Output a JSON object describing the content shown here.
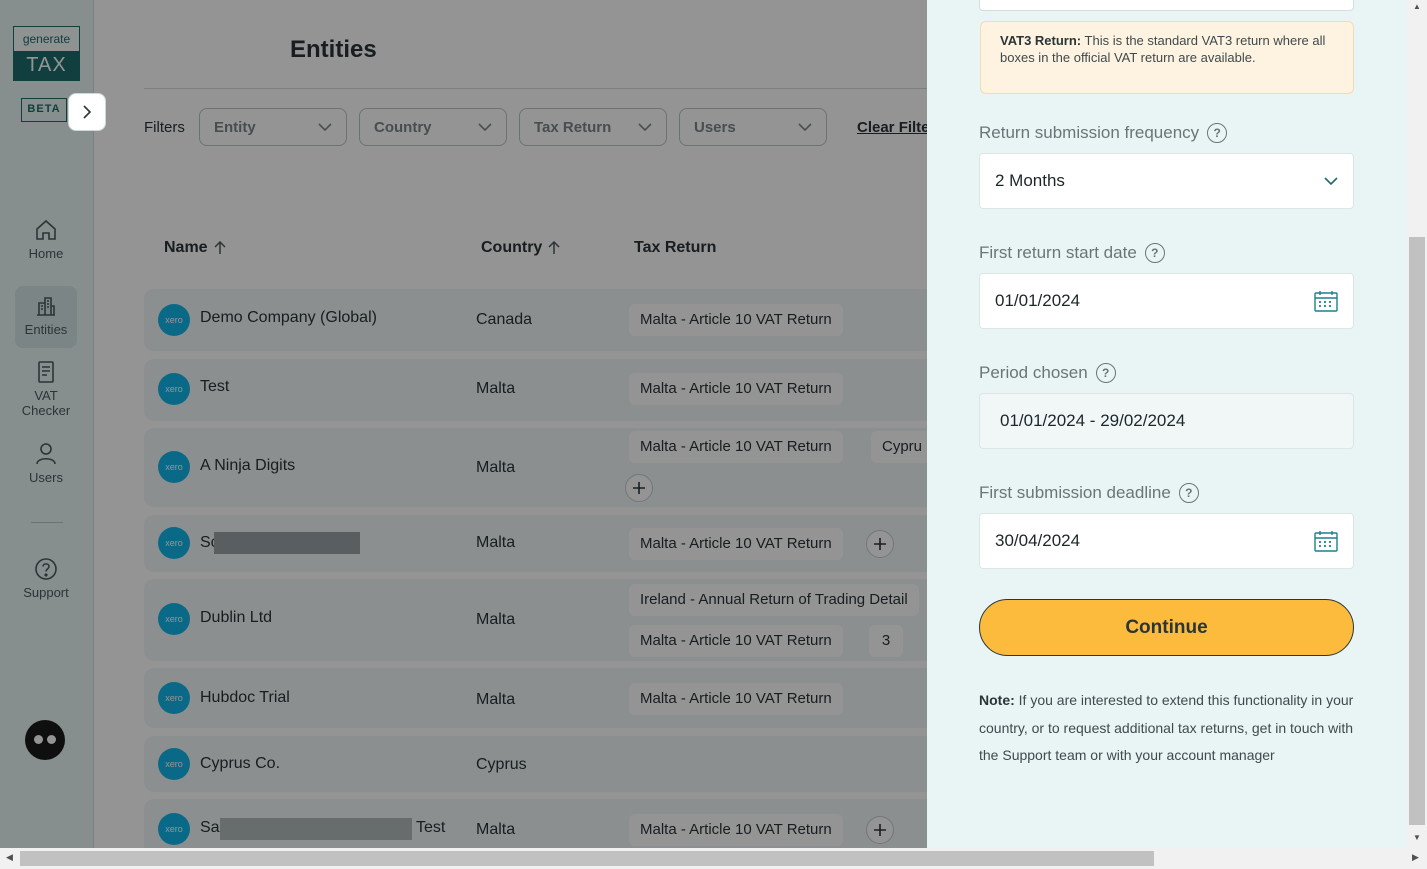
{
  "sidebar": {
    "logo_top": "generate",
    "logo_bottom": "TAX",
    "beta": "BETA",
    "nav": [
      {
        "label": "Home",
        "icon": "home-icon"
      },
      {
        "label": "Entities",
        "icon": "buildings-icon"
      },
      {
        "label": "VAT Checker",
        "icon": "document-icon"
      },
      {
        "label": "Users",
        "icon": "user-icon"
      },
      {
        "label": "Support",
        "icon": "help-circle-icon"
      }
    ]
  },
  "main": {
    "title": "Entities",
    "filters_label": "Filters",
    "filters": [
      "Entity",
      "Country",
      "Tax Return",
      "Users"
    ],
    "clear_filters": "Clear Filte",
    "columns": [
      "Name",
      "Country",
      "Tax Return"
    ],
    "rows": [
      {
        "name": "Demo Company (Global)",
        "country": "Canada",
        "tags": [
          "Malta - Article 10 VAT Return"
        ]
      },
      {
        "name": "Test",
        "country": "Malta",
        "tags": [
          "Malta - Article 10 VAT Return"
        ]
      },
      {
        "name": "A Ninja Digits",
        "country": "Malta",
        "tags": [
          "Malta - Article 10 VAT Return",
          "Cypru"
        ]
      },
      {
        "name": "Sc",
        "country": "Malta",
        "tags": [
          "Malta - Article 10 VAT Return"
        ]
      },
      {
        "name": "Dublin Ltd",
        "country": "Malta",
        "tags": [
          "Ireland - Annual Return of Trading Detail",
          "Malta - Article 10 VAT Return",
          "3"
        ]
      },
      {
        "name": "Hubdoc Trial",
        "country": "Malta",
        "tags": [
          "Malta - Article 10 VAT Return"
        ]
      },
      {
        "name": "Cyprus Co.",
        "country": "Cyprus",
        "tags": []
      },
      {
        "name": "Sa",
        "name_suffix": "Test",
        "country": "Malta",
        "tags": [
          "Malta - Article 10 VAT Return"
        ]
      }
    ],
    "xero_label": "xero"
  },
  "drawer": {
    "info_bold": "VAT3 Return:",
    "info_text": "This is the standard VAT3 return where all boxes in the official VAT return are available.",
    "frequency_label": "Return submission frequency",
    "frequency_value": "2 Months",
    "start_label": "First return start date",
    "start_value": "01/01/2024",
    "period_label": "Period chosen",
    "period_value": "01/01/2024 - 29/02/2024",
    "deadline_label": "First submission deadline",
    "deadline_value": "30/04/2024",
    "continue_label": "Continue",
    "note_bold": "Note:",
    "note_text": "If you are interested to extend this functionality in your country, or to request additional tax returns, get in touch with the Support team or with your account manager",
    "help_glyph": "?"
  },
  "colors": {
    "accent": "#fdbb3d",
    "brand": "#1e6b6b",
    "xero": "#13b5ea",
    "drawer_bg": "#e9f5f4",
    "info_bg": "#fef3e0"
  }
}
